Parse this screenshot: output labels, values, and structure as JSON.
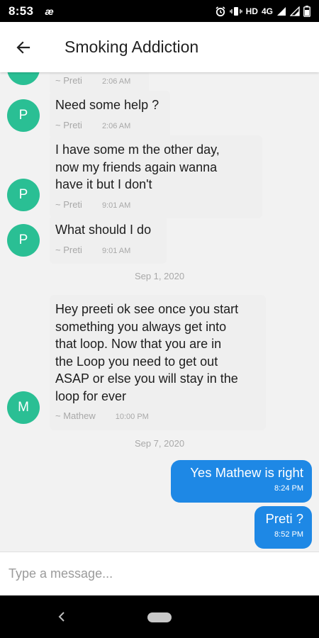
{
  "status_bar": {
    "time": "8:53",
    "app_icon": "æ",
    "hd_label": "HD",
    "network": "4G"
  },
  "header": {
    "title": "Smoking Addiction",
    "back_icon": "arrow-left-icon"
  },
  "colors": {
    "avatar": "#2abf94",
    "outgoing": "#1e88e5"
  },
  "messages": [
    {
      "avatar": "P",
      "text": "",
      "sender": "~ Preti",
      "time": "2:06 AM"
    },
    {
      "avatar": "P",
      "text": "Need some help ?",
      "sender": "~ Preti",
      "time": "2:06 AM"
    },
    {
      "avatar": "P",
      "text": "I have some m the other day,\nnow my friends again wanna\nhave it but I don't",
      "sender": "~ Preti",
      "time": "9:01 AM"
    },
    {
      "avatar": "P",
      "text": "What should I do",
      "sender": "~ Preti",
      "time": "9:01 AM"
    },
    {
      "avatar": "M",
      "text": "Hey preeti ok see once you start\nsomething you always get into\nthat loop. Now that you are in\nthe Loop you need to get out\nASAP or else you will stay in the\nloop for ever",
      "sender": "~ Mathew",
      "time": "10:00 PM"
    }
  ],
  "dates": [
    "Sep 1, 2020",
    "Sep 7, 2020"
  ],
  "outgoing": [
    {
      "text": "Yes Mathew is right",
      "time": "8:24 PM"
    },
    {
      "text": "Preti ?",
      "time": "8:52 PM"
    }
  ],
  "composer": {
    "placeholder": "Type a message..."
  }
}
